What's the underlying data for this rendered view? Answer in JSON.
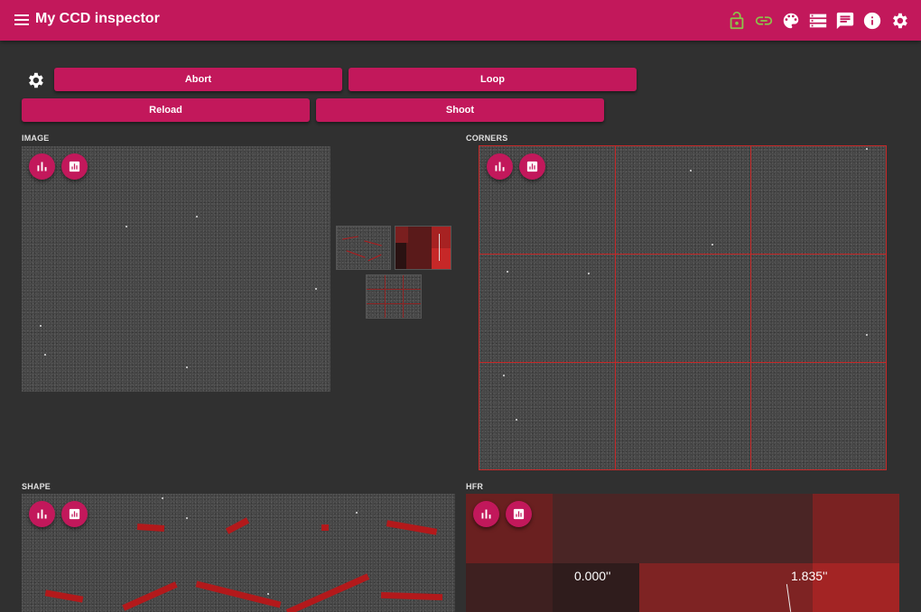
{
  "app": {
    "title": "My CCD inspector"
  },
  "toolbar": {
    "icons": [
      "menu-icon",
      "lock-open-icon",
      "link-icon",
      "palette-icon",
      "storage-icon",
      "feedback-icon",
      "info-icon",
      "settings-icon"
    ],
    "lock_color": "#8bc34a",
    "link_color": "#8bc34a"
  },
  "actions": {
    "abort": "Abort",
    "loop": "Loop",
    "reload": "Reload",
    "shoot": "Shoot"
  },
  "sections": {
    "image": "IMAGE",
    "corners": "CORNERS",
    "shape": "SHAPE",
    "hfr": "HFR"
  },
  "hfr": {
    "values": [
      "0.000''",
      "1.835''"
    ]
  },
  "colors": {
    "accent": "#c2185b",
    "background": "#303030",
    "overlay_red": "#c62828"
  }
}
